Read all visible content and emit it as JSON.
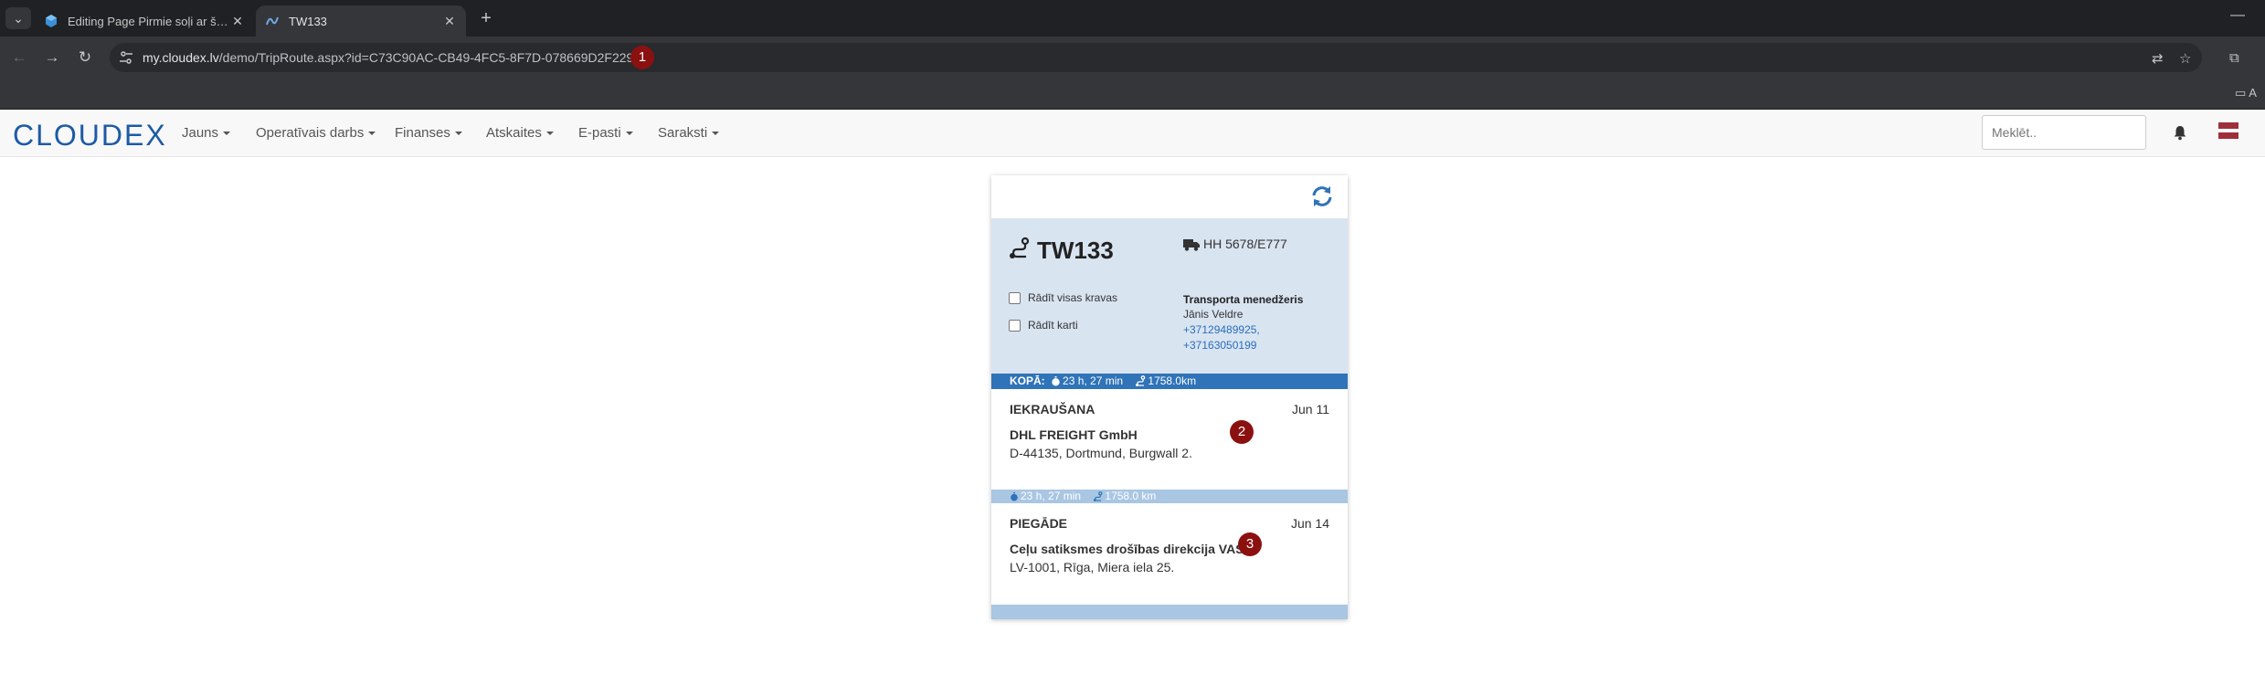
{
  "browser": {
    "tabs": [
      {
        "title": "Editing Page Pirmie soļi ar šofe",
        "active": false
      },
      {
        "title": "TW133",
        "active": true
      }
    ],
    "url_host": "my.cloudex.lv",
    "url_path": "/demo/TripRoute.aspx?id=C73C90AC-CB49-4FC5-8F7D-078669D2F229",
    "bookmark_folder": "A"
  },
  "markers": [
    "1",
    "2",
    "3"
  ],
  "app": {
    "logo": "CLOUDEX",
    "menu": [
      "Jauns",
      "Operatīvais darbs",
      "Finanses",
      "Atskaites",
      "E-pasti",
      "Saraksti"
    ],
    "search_placeholder": "Meklēt.."
  },
  "trip": {
    "id": "TW133",
    "truck": "HH 5678/E777",
    "show_all_cargo": "Rādīt visas kravas",
    "show_map": "Rādīt karti",
    "manager_title": "Transporta menedžeris",
    "manager_name": "Jānis Veldre",
    "phones": [
      "+37129489925,",
      "+37163050199"
    ],
    "total_label": "KOPĀ:",
    "total_time": "23 h, 27 min",
    "total_distance": "1758.0km",
    "stops": [
      {
        "type": "IEKRAUŠANA",
        "date": "Jun 11",
        "company": "DHL FREIGHT GmbH",
        "address": "D-44135, Dortmund, Burgwall 2."
      },
      {
        "type": "PIEGĀDE",
        "date": "Jun 14",
        "company": "Ceļu satiksmes drošības direkcija VAS",
        "address": "LV-1001, Rīga, Miera iela 25."
      }
    ],
    "segment": {
      "time": "23 h, 27 min",
      "distance": "1758.0 km"
    }
  },
  "colors": {
    "brand": "#1c5aa6",
    "head_bg": "#d9e4f1",
    "total_bar": "#2f73b8",
    "segment_bar": "#a9c6e3",
    "marker": "#8b1010"
  }
}
